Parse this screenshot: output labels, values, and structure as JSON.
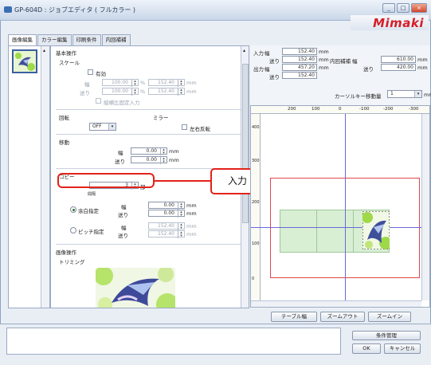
{
  "window": {
    "title": "GP-604D : ジョブエディタ ( フルカラー )",
    "logo": "Mimaki",
    "min": "_",
    "max": "□",
    "close": "×"
  },
  "tabs": [
    "画像編集",
    "カラー編集",
    "印刷条件",
    "内回補補"
  ],
  "basic": {
    "heading": "基本操作",
    "scale": {
      "label": "スケール",
      "enabled_label": "有効",
      "width_label": "幅",
      "height_label": "送り",
      "width_pct": "100.00",
      "height_pct": "100.00",
      "pct_unit": "%",
      "width_mm": "152.40",
      "height_mm": "152.40",
      "mm_unit": "mm",
      "keep_ratio_label": "縦横比固定入力"
    },
    "rotate": {
      "label": "回転",
      "value": "OFF"
    },
    "mirror": {
      "label": "ミラー",
      "lr_label": "左右反転"
    },
    "move": {
      "label": "移動",
      "width_label": "幅",
      "height_label": "送り",
      "width_value": "0.00",
      "height_value": "0.00",
      "unit": "mm"
    },
    "copy": {
      "label": "コピー",
      "count": "3",
      "unit": "部",
      "spacing_label": "間隔",
      "margin_label": "余白指定",
      "margin_width": "0.00",
      "margin_feed": "0.00",
      "pitch_label": "ピッチ指定",
      "pitch_width": "152.40",
      "pitch_feed": "152.40",
      "width_label": "幅",
      "feed_label": "送り",
      "unit_mm": "mm"
    }
  },
  "image_ops": {
    "heading": "画像操作",
    "trimming": "トリミング"
  },
  "callout": {
    "label": "入力"
  },
  "info": {
    "input_label": "入力",
    "output_label": "出力",
    "width_label": "幅",
    "feed_label": "送り",
    "input_width": "152.40",
    "input_feed": "152.40",
    "output_width": "457.20",
    "output_feed": "152.40",
    "unit": "mm",
    "area_label": "内回補補",
    "area_width": "610.00",
    "area_feed": "420.00"
  },
  "cursor": {
    "label": "カーソルキー移動量",
    "value": "1",
    "unit": "mm"
  },
  "ruler": {
    "top_ticks": [
      "200",
      "100",
      "0",
      "-100",
      "-200",
      "-300"
    ],
    "left_ticks": [
      "400",
      "300",
      "200",
      "100",
      "0"
    ]
  },
  "canvas_buttons": {
    "table_width": "テーブル幅",
    "zoom_out": "ズームアウト",
    "zoom_in": "ズームイン"
  },
  "footer": {
    "conditions": "条件管理",
    "ok": "OK",
    "cancel": "キャンセル"
  }
}
